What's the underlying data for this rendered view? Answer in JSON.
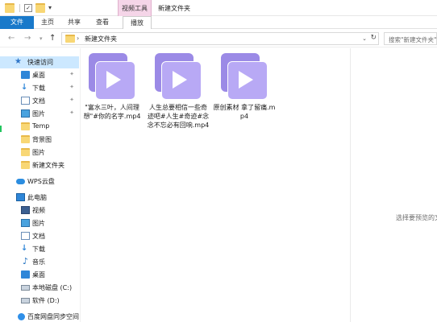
{
  "titlebar": {
    "context_tab": "视频工具",
    "window_title": "新建文件夹"
  },
  "ribbon": {
    "tabs": [
      "文件",
      "主页",
      "共享",
      "查看",
      "播放"
    ]
  },
  "address": {
    "path": "新建文件夹",
    "search_placeholder": "搜索\"新建文件夹\""
  },
  "nav": {
    "quick_access": "快速访问",
    "quick_items": [
      {
        "label": "桌面",
        "icon": "desktop-icon",
        "pinned": true
      },
      {
        "label": "下载",
        "icon": "download-icon",
        "pinned": true
      },
      {
        "label": "文档",
        "icon": "document-icon",
        "pinned": true
      },
      {
        "label": "图片",
        "icon": "picture-icon",
        "pinned": true
      },
      {
        "label": "Temp",
        "icon": "folder-icon",
        "pinned": false
      },
      {
        "label": "背景图",
        "icon": "folder-icon",
        "pinned": false
      },
      {
        "label": "图片",
        "icon": "folder-icon",
        "pinned": false
      },
      {
        "label": "新建文件夹",
        "icon": "folder-icon",
        "pinned": false
      }
    ],
    "wps": "WPS云盘",
    "this_pc": "此电脑",
    "pc_items": [
      {
        "label": "视频",
        "icon": "video-icon"
      },
      {
        "label": "图片",
        "icon": "picture-icon"
      },
      {
        "label": "文档",
        "icon": "document-icon"
      },
      {
        "label": "下载",
        "icon": "download-icon"
      },
      {
        "label": "音乐",
        "icon": "music-icon"
      },
      {
        "label": "桌面",
        "icon": "desktop-icon"
      },
      {
        "label": "本地磁盘 (C:)",
        "icon": "drive-icon"
      },
      {
        "label": "软件 (D:)",
        "icon": "drive-icon"
      }
    ],
    "baidu": "百度网盘同步空间"
  },
  "files": [
    {
      "name": "\"富水三叶，人间理想\"#你的名字.mp4"
    },
    {
      "name": "人生总要相信一些奇迹吧#人生#奇迹#念念不忘必有回响.mp4"
    },
    {
      "name": "原创素材 拿了留痛.mp4"
    }
  ],
  "preview": {
    "text": "选择要预览的文"
  },
  "colors": {
    "accent": "#1979ca",
    "context_tab": "#f5d5e8",
    "selected": "#cce8ff",
    "thumb": "#b8a9f5"
  }
}
